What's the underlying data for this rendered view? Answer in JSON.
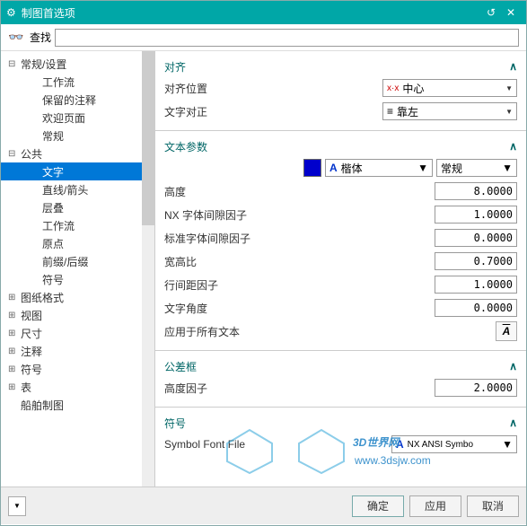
{
  "window": {
    "title": "制图首选项"
  },
  "search": {
    "label": "查找",
    "value": ""
  },
  "tree": [
    {
      "depth": 1,
      "twist": "-",
      "label": "常规/设置"
    },
    {
      "depth": 2,
      "twist": "",
      "label": "工作流"
    },
    {
      "depth": 2,
      "twist": "",
      "label": "保留的注释"
    },
    {
      "depth": 2,
      "twist": "",
      "label": "欢迎页面"
    },
    {
      "depth": 2,
      "twist": "",
      "label": "常规"
    },
    {
      "depth": 1,
      "twist": "-",
      "label": "公共"
    },
    {
      "depth": 2,
      "twist": "",
      "label": "文字",
      "selected": true
    },
    {
      "depth": 2,
      "twist": "",
      "label": "直线/箭头"
    },
    {
      "depth": 2,
      "twist": "",
      "label": "层叠"
    },
    {
      "depth": 2,
      "twist": "",
      "label": "工作流"
    },
    {
      "depth": 2,
      "twist": "",
      "label": "原点"
    },
    {
      "depth": 2,
      "twist": "",
      "label": "前缀/后缀"
    },
    {
      "depth": 2,
      "twist": "",
      "label": "符号"
    },
    {
      "depth": 1,
      "twist": "+",
      "label": "图纸格式"
    },
    {
      "depth": 1,
      "twist": "+",
      "label": "视图"
    },
    {
      "depth": 1,
      "twist": "+",
      "label": "尺寸"
    },
    {
      "depth": 1,
      "twist": "+",
      "label": "注释"
    },
    {
      "depth": 1,
      "twist": "+",
      "label": "符号"
    },
    {
      "depth": 1,
      "twist": "+",
      "label": "表"
    },
    {
      "depth": 1,
      "twist": "",
      "label": "船舶制图"
    }
  ],
  "align": {
    "title": "对齐",
    "pos_label": "对齐位置",
    "pos_value": "中心",
    "pos_prefix": "x·x",
    "just_label": "文字对正",
    "just_value": "靠左"
  },
  "textparam": {
    "title": "文本参数",
    "color": "#0000CC",
    "font": "楷体",
    "style": "常规",
    "rows": [
      {
        "label": "高度",
        "value": "8.0000"
      },
      {
        "label": "NX 字体间隙因子",
        "value": "1.0000"
      },
      {
        "label": "标准字体间隙因子",
        "value": "0.0000"
      },
      {
        "label": "宽高比",
        "value": "0.7000"
      },
      {
        "label": "行间距因子",
        "value": "1.0000"
      },
      {
        "label": "文字角度",
        "value": "0.0000"
      }
    ],
    "apply_label": "应用于所有文本"
  },
  "tolbox": {
    "title": "公差框",
    "height_label": "高度因子",
    "height_value": "2.0000"
  },
  "symbol": {
    "title": "符号",
    "font_label": "Symbol Font File",
    "font_value": "NX ANSI Symbo"
  },
  "footer": {
    "ok": "确定",
    "apply": "应用",
    "cancel": "取消"
  },
  "watermark": {
    "text": "3D世界网",
    "url": "www.3dsjw.com"
  }
}
